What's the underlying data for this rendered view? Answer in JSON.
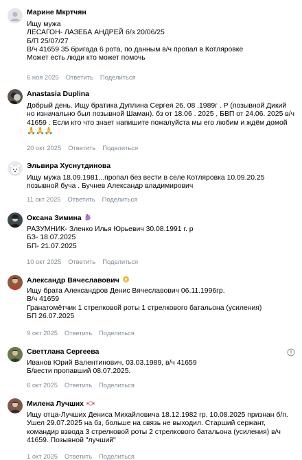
{
  "actions": {
    "reply": "Ответить",
    "share": "Поделиться"
  },
  "comments": [
    {
      "author": "Марине Мкртчян",
      "text": "Ищу мужа\nЛЕСАГОН- ЛАЗЕБА АНДРЕЙ б/з 20/06/25\nБ/П 25/07/27\nВ/ч 41659 35 бригада 6 рота, по данным в/ч пропал в Котляровке\nМожет есть люди кто может помочь",
      "date": "6 ноя 2025"
    },
    {
      "author": "Anastasia Duplina",
      "text": "Добрый день. Ищу братика Дуплина Сергея 26. 08 .1989г . Р (позывной Дикий но изначально был позывной Шаман). бз от 18.06 . 2025 , БВП от 24.06. 2025 в/ч 41659 . Если кто что знает напишите пожалуйста мы его любим и ждём домой 🙏🙏🙏",
      "date": "20 окт 2025"
    },
    {
      "author": "Эльвира Хуснутдинова",
      "text": "Ищу мужа 18.09.1981...пропал без вести в селе Котляровка 10.09.20.25 позывной буча . Бучнев Александр владимирович",
      "date": "11 окт 2025"
    },
    {
      "author": "Оксана Зимина",
      "text": "РАЗУМНИК- Зленко Илья Юрьевич 30.08.1991 г. р\nБЗ- 18.07.2025\nБП- 21.07.2025",
      "date": "10 окт 2025"
    },
    {
      "author": "Александр Вячеславович",
      "text": "Ищу брата Александров Денис Вячеславович 06.11.1996гр.\nВ/ч 41659\nГранатомётчик 1 стрелковой роты 1 стрелкового батальона (усиления)\nБП 26.07.2025",
      "date": "9 окт 2025"
    },
    {
      "author": "Светтлана Сергеева",
      "text": "Иванов Юрий Валентинович, 03.03.1989, в/ч 41659\nБ/вести пропавший 08.07.2025.",
      "date": "6 окт 2025"
    },
    {
      "author": "Милена Лучших",
      "text": "Ищу отца-Лучших Дениса Михайловича 18.12.1982 гр. 10.08.2025 признан б/п. Ушел 29.07.2025 на бз, больше на связь не выходил. Старший сержант, командир взвода 3 стрелковой роты 2 стрелкового батальона (усиления) в/ч 41659. Позывной \"лучший\"",
      "date": "1 окт 2025"
    }
  ],
  "colors": {
    "meta": "#818c99",
    "text": "#000000",
    "background": "#ffffff"
  }
}
